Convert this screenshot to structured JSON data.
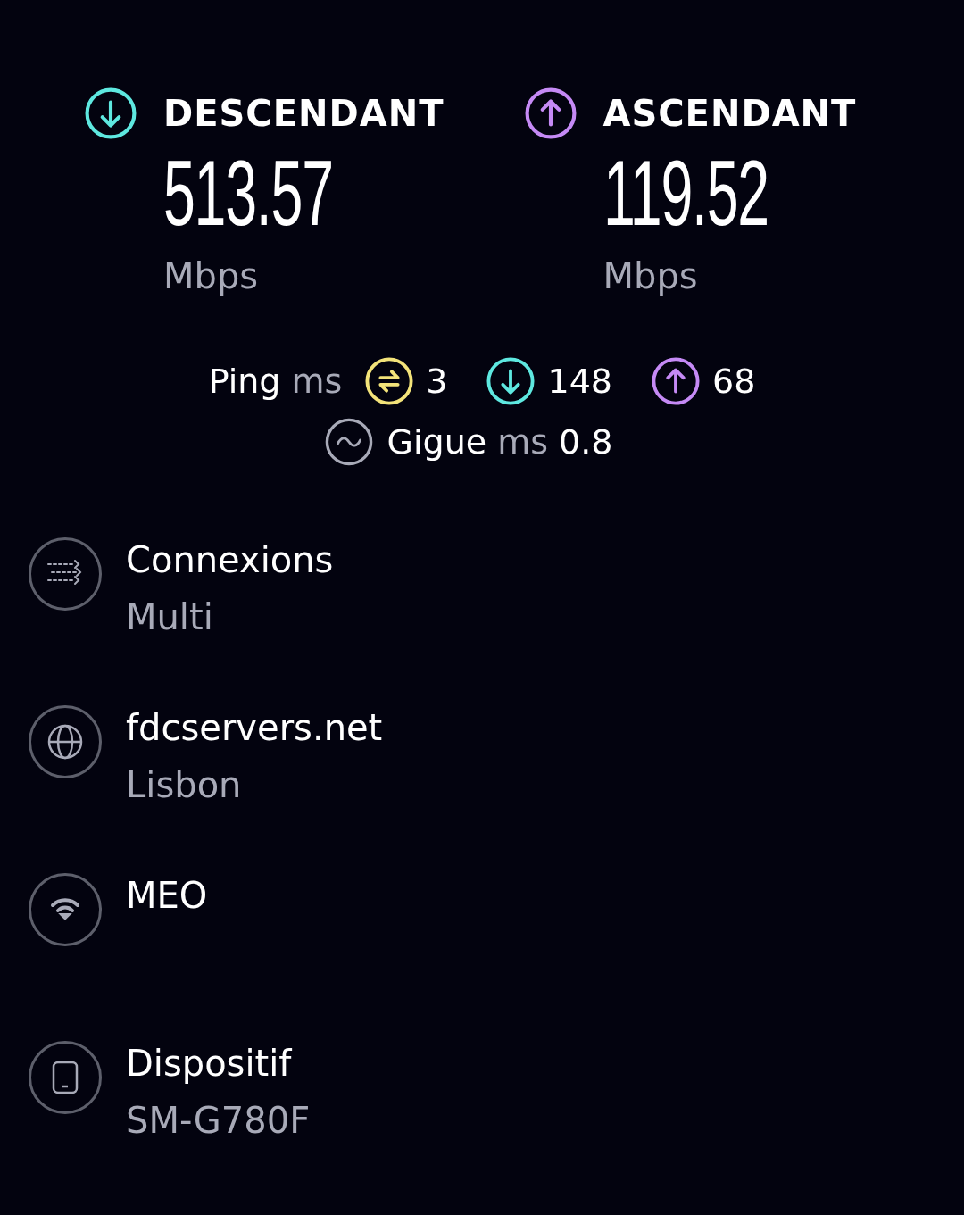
{
  "speeds": [
    {
      "kind": "download",
      "label": "DESCENDANT",
      "value": "513.57",
      "unit": "Mbps",
      "color": "#5ee8e0"
    },
    {
      "kind": "upload",
      "label": "ASCENDANT",
      "value": "119.52",
      "unit": "Mbps",
      "color": "#c58af5"
    }
  ],
  "ping": {
    "label": "Ping",
    "unit": "ms",
    "items": [
      {
        "kind": "idle",
        "value": "3",
        "color": "#f3e37a"
      },
      {
        "kind": "download",
        "value": "148",
        "color": "#5ee8e0"
      },
      {
        "kind": "upload",
        "value": "68",
        "color": "#c58af5"
      }
    ]
  },
  "jitter": {
    "label": "Gigue",
    "unit": "ms",
    "value": "0.8"
  },
  "details": [
    {
      "kind": "connections",
      "title": "Connexions",
      "subtitle": "Multi"
    },
    {
      "kind": "server",
      "title": "fdcservers.net",
      "subtitle": "Lisbon"
    },
    {
      "kind": "network",
      "title": "MEO"
    },
    {
      "kind": "device",
      "title": "Dispositif",
      "subtitle": "SM-G780F"
    }
  ]
}
